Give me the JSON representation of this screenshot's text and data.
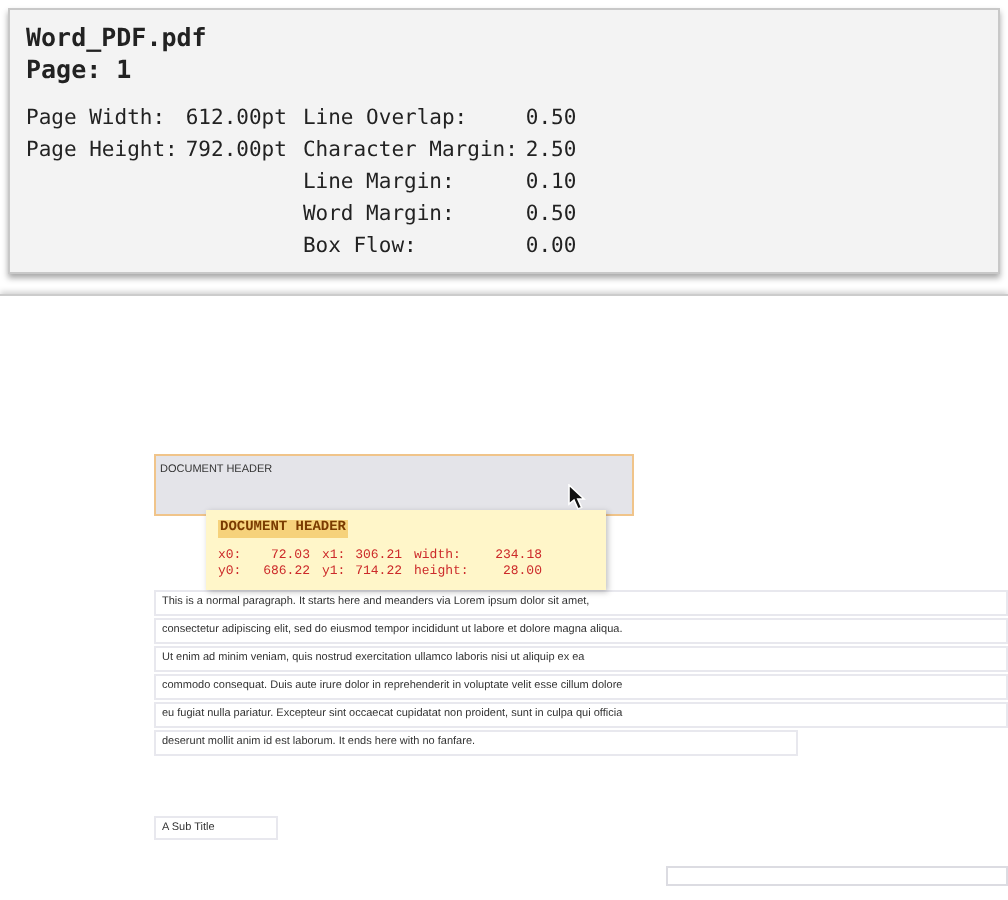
{
  "file": {
    "name": "Word_PDF.pdf",
    "page": "Page: 1"
  },
  "page_props": [
    {
      "label": "Page Width:",
      "value": "612.00pt"
    },
    {
      "label": "Page Height:",
      "value": "792.00pt"
    }
  ],
  "layout_params": [
    {
      "label": "Line Overlap:",
      "value": "0.50"
    },
    {
      "label": "Character Margin:",
      "value": "2.50"
    },
    {
      "label": "Line Margin:",
      "value": "0.10"
    },
    {
      "label": "Word Margin:",
      "value": "0.50"
    },
    {
      "label": "Box Flow:",
      "value": "0.00"
    }
  ],
  "document": {
    "header": "DOCUMENT HEADER",
    "tooltip": {
      "title": "DOCUMENT HEADER",
      "coords": [
        {
          "label": "x0:",
          "value": "72.03"
        },
        {
          "label": "x1:",
          "value": "306.21"
        },
        {
          "label": "width:",
          "value": "234.18"
        },
        {
          "label": "y0:",
          "value": "686.22"
        },
        {
          "label": "y1:",
          "value": "714.22"
        },
        {
          "label": "height:",
          "value": "28.00"
        }
      ]
    },
    "paragraph_lines": [
      "This is a normal paragraph. It starts here and meanders via Lorem ipsum dolor sit amet,",
      "consectetur adipiscing elit, sed do eiusmod tempor incididunt ut labore et dolore magna aliqua.",
      "Ut enim ad minim veniam, quis nostrud exercitation ullamco laboris nisi ut aliquip ex ea",
      "commodo consequat. Duis aute irure dolor in reprehenderit in voluptate velit esse cillum dolore",
      "eu fugiat nulla pariatur. Excepteur sint occaecat cupidatat non proident, sunt in culpa qui officia",
      "deserunt mollit anim id est laborum. It ends here with no fanfare."
    ],
    "subtitle": "A Sub Title"
  }
}
